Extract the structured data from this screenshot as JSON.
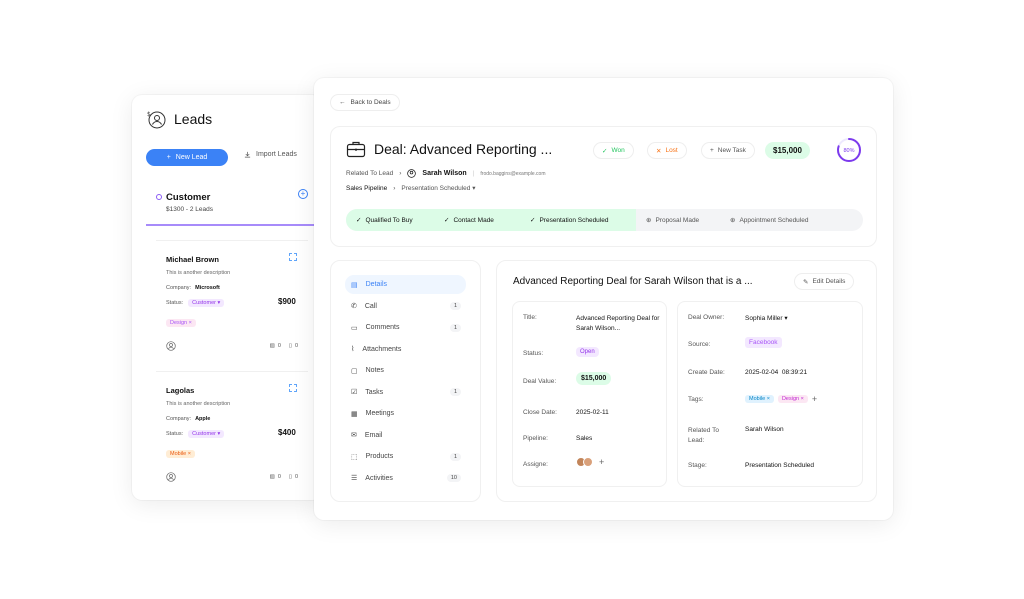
{
  "leads": {
    "title": "Leads",
    "new_lead": "New Lead",
    "import_leads": "Import Leads",
    "group": {
      "name": "Customer",
      "summary": "$1300 - 2 Leads"
    },
    "cards": [
      {
        "name": "Michael Brown",
        "description": "This is another description",
        "company_label": "Company:",
        "company": "Microsoft",
        "status_label": "Status:",
        "status": "Customer",
        "price": "$900",
        "tag": "Design",
        "images": "0",
        "files": "0"
      },
      {
        "name": "Lagolas",
        "description": "This is another description",
        "company_label": "Company:",
        "company": "Apple",
        "status_label": "Status:",
        "status": "Customer",
        "price": "$400",
        "tag": "Mobile",
        "images": "0",
        "files": "0"
      }
    ]
  },
  "deal": {
    "back": "Back to Deals",
    "title": "Deal: Advanced Reporting ...",
    "won": "Won",
    "lost": "Lost",
    "new_task": "New Task",
    "value": "$15,000",
    "progress": "80%",
    "progress_fraction": 0.8,
    "related_label": "Related To Lead",
    "related_name": "Sarah Wilson",
    "related_email": "frodo.baggins@example.com",
    "pipeline": "Sales Pipeline",
    "stage_select": "Presentation Scheduled",
    "stages": [
      {
        "label": "Qualified To Buy",
        "done": true
      },
      {
        "label": "Contact Made",
        "done": true
      },
      {
        "label": "Presentation Scheduled",
        "done": true
      },
      {
        "label": "Proposal Made",
        "done": false
      },
      {
        "label": "Appointment Scheduled",
        "done": false
      }
    ]
  },
  "nav": [
    {
      "label": "Details",
      "icon": "file-icon",
      "count": ""
    },
    {
      "label": "Call",
      "icon": "phone-icon",
      "count": "1"
    },
    {
      "label": "Comments",
      "icon": "comment-icon",
      "count": "1"
    },
    {
      "label": "Attachments",
      "icon": "paperclip-icon",
      "count": ""
    },
    {
      "label": "Notes",
      "icon": "note-icon",
      "count": ""
    },
    {
      "label": "Tasks",
      "icon": "task-icon",
      "count": "1"
    },
    {
      "label": "Meetings",
      "icon": "calendar-icon",
      "count": ""
    },
    {
      "label": "Email",
      "icon": "mail-icon",
      "count": ""
    },
    {
      "label": "Products",
      "icon": "box-icon",
      "count": "1"
    },
    {
      "label": "Activities",
      "icon": "list-icon",
      "count": "10"
    }
  ],
  "details": {
    "heading": "Advanced Reporting Deal for Sarah Wilson that is a ...",
    "edit": "Edit Details",
    "left": {
      "title_label": "Title:",
      "title_value": "Advanced Reporting Deal for Sarah Wilson...",
      "status_label": "Status:",
      "status_value": "Open",
      "value_label": "Deal Value:",
      "value_value": "$15,000",
      "close_label": "Close Date:",
      "close_value": "2025-02-11",
      "pipeline_label": "Pipeline:",
      "pipeline_value": "Sales",
      "assignee_label": "Assigne:"
    },
    "right": {
      "owner_label": "Deal Owner:",
      "owner_value": "Sophia Miller",
      "source_label": "Source:",
      "source_value": "Facebook",
      "created_label": "Create Date:",
      "created_value": "2025-02-04  08:39:21",
      "tags_label": "Tags:",
      "tag1": "Mobile",
      "tag2": "Design",
      "related_label": "Related To Lead:",
      "related_value": "Sarah Wilson",
      "stage_label": "Stage:",
      "stage_value": "Presentation Scheduled"
    }
  }
}
